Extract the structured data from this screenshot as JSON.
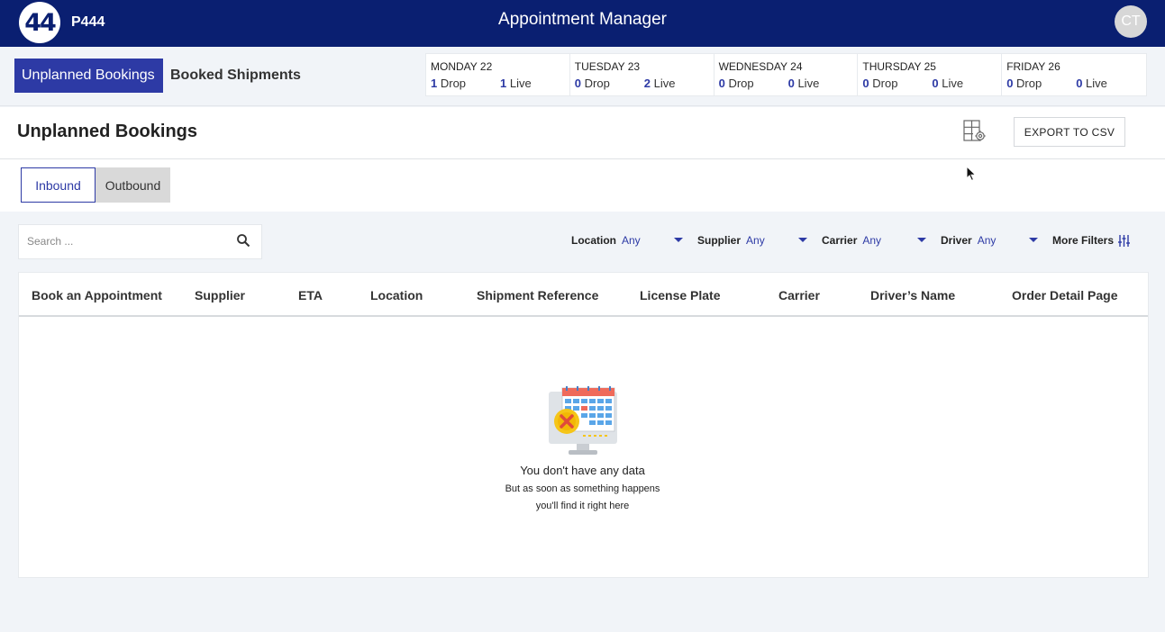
{
  "header": {
    "logo_text": "44",
    "site_code": "P444",
    "app_title": "Appointment Manager",
    "avatar_initials": "CT"
  },
  "nav": {
    "tabs": [
      {
        "label": "Unplanned Bookings",
        "active": true
      },
      {
        "label": "Booked Shipments",
        "active": false
      }
    ]
  },
  "days": [
    {
      "name": "MONDAY 22",
      "drop_count": "1",
      "drop_label": "Drop",
      "live_count": "1",
      "live_label": "Live"
    },
    {
      "name": "TUESDAY 23",
      "drop_count": "0",
      "drop_label": "Drop",
      "live_count": "2",
      "live_label": "Live"
    },
    {
      "name": "WEDNESDAY 24",
      "drop_count": "0",
      "drop_label": "Drop",
      "live_count": "0",
      "live_label": "Live"
    },
    {
      "name": "THURSDAY 25",
      "drop_count": "0",
      "drop_label": "Drop",
      "live_count": "0",
      "live_label": "Live"
    },
    {
      "name": "FRIDAY 26",
      "drop_count": "0",
      "drop_label": "Drop",
      "live_count": "0",
      "live_label": "Live"
    }
  ],
  "page": {
    "title": "Unplanned Bookings",
    "export_label": "EXPORT TO CSV",
    "direction_tabs": [
      {
        "label": "Inbound",
        "active": true
      },
      {
        "label": "Outbound",
        "active": false
      }
    ]
  },
  "search": {
    "placeholder": "Search ...",
    "value": ""
  },
  "filters": [
    {
      "label": "Location",
      "value": "Any"
    },
    {
      "label": "Supplier",
      "value": "Any"
    },
    {
      "label": "Carrier",
      "value": "Any"
    },
    {
      "label": "Driver",
      "value": "Any"
    }
  ],
  "more_filters_label": "More Filters",
  "table": {
    "columns": [
      "Book an Appointment",
      "Supplier",
      "ETA",
      "Location",
      "Shipment Reference",
      "License Plate",
      "Carrier",
      "Driver’s Name",
      "Order Detail Page"
    ]
  },
  "empty_state": {
    "title": "You don't have any data",
    "line1": "But as soon as something happens",
    "line2": "you'll find it right here"
  },
  "colors": {
    "topbar": "#0a1f71",
    "accent": "#2d3aa5",
    "background": "#f1f4f8"
  }
}
